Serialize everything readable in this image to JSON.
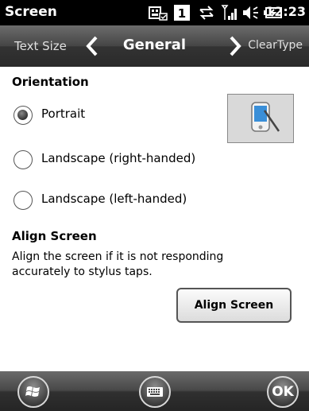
{
  "status_bar": {
    "title": "Screen",
    "time": "12:23",
    "icons": [
      "keyboard-sync-icon",
      "notification-1-icon",
      "data-transfer-icon",
      "signal-strength-icon",
      "volume-icon",
      "battery-icon"
    ],
    "notification_count": "1"
  },
  "tab_bar": {
    "prev_tab": "Text Size",
    "current_tab": "General",
    "next_tab": "ClearType"
  },
  "orientation": {
    "title": "Orientation",
    "options": [
      {
        "label": "Portrait",
        "checked": true
      },
      {
        "label": "Landscape (right-handed)",
        "checked": false
      },
      {
        "label": "Landscape (left-handed)",
        "checked": false
      }
    ]
  },
  "align_screen": {
    "title": "Align Screen",
    "description": "Align the screen if it is not responding accurately to stylus taps.",
    "button_label": "Align Screen"
  },
  "bottom_bar": {
    "start_icon": "windows-start-icon",
    "keyboard_icon": "keyboard-icon",
    "ok_label": "OK"
  },
  "colors": {
    "status_bar_bg": "#000000",
    "tab_bar_bg": "#3a3a3a",
    "bottom_bar_bg": "#303030"
  }
}
